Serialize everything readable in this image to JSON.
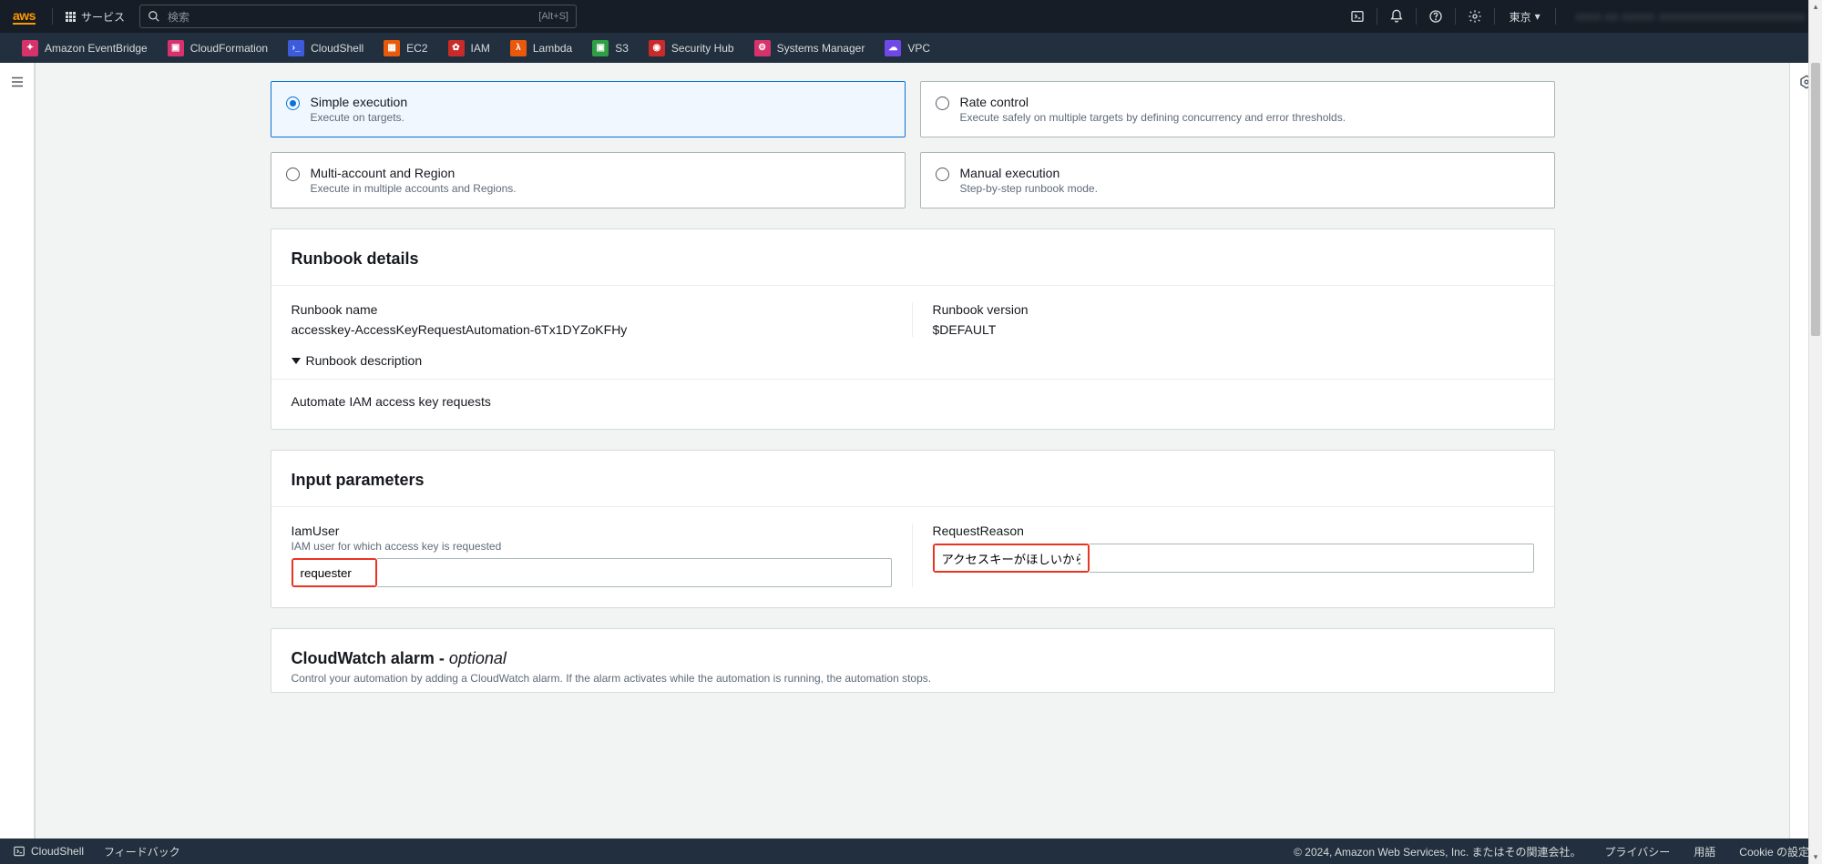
{
  "nav": {
    "logo": "aws",
    "services_label": "サービス",
    "search_placeholder": "検索",
    "search_shortcut": "[Alt+S]",
    "region": "東京",
    "account_blur": "xxxx-xx-xxxxx  xxxxxxxxxxxxxxxxxxxxxxx"
  },
  "service_bar": [
    {
      "label": "Amazon EventBridge",
      "color": "c-pink"
    },
    {
      "label": "CloudFormation",
      "color": "c-pink"
    },
    {
      "label": "CloudShell",
      "color": "c-blue"
    },
    {
      "label": "EC2",
      "color": "c-orange"
    },
    {
      "label": "IAM",
      "color": "c-red"
    },
    {
      "label": "Lambda",
      "color": "c-orange"
    },
    {
      "label": "S3",
      "color": "c-green"
    },
    {
      "label": "Security Hub",
      "color": "c-red"
    },
    {
      "label": "Systems Manager",
      "color": "c-pink"
    },
    {
      "label": "VPC",
      "color": "c-purple"
    }
  ],
  "execution_options": {
    "simple": {
      "title": "Simple execution",
      "desc": "Execute on targets."
    },
    "rate": {
      "title": "Rate control",
      "desc": "Execute safely on multiple targets by defining concurrency and error thresholds."
    },
    "multi": {
      "title": "Multi-account and Region",
      "desc": "Execute in multiple accounts and Regions."
    },
    "manual": {
      "title": "Manual execution",
      "desc": "Step-by-step runbook mode."
    }
  },
  "runbook": {
    "panel_title": "Runbook details",
    "name_label": "Runbook name",
    "name_value": "accesskey-AccessKeyRequestAutomation-6Tx1DYZoKFHy",
    "version_label": "Runbook version",
    "version_value": "$DEFAULT",
    "expander_label": "Runbook description",
    "description": "Automate IAM access key requests"
  },
  "params": {
    "panel_title": "Input parameters",
    "iamuser": {
      "label": "IamUser",
      "help": "IAM user for which access key is requested",
      "value": "requester"
    },
    "reason": {
      "label": "RequestReason",
      "value": "アクセスキーがほしいから"
    }
  },
  "cloudwatch": {
    "title_main": "CloudWatch alarm - ",
    "title_em": "optional",
    "desc": "Control your automation by adding a CloudWatch alarm. If the alarm activates while the automation is running, the automation stops."
  },
  "footer": {
    "cloudshell": "CloudShell",
    "feedback": "フィードバック",
    "copyright": "© 2024, Amazon Web Services, Inc. またはその関連会社。",
    "privacy": "プライバシー",
    "terms": "用語",
    "cookies": "Cookie の設定"
  }
}
